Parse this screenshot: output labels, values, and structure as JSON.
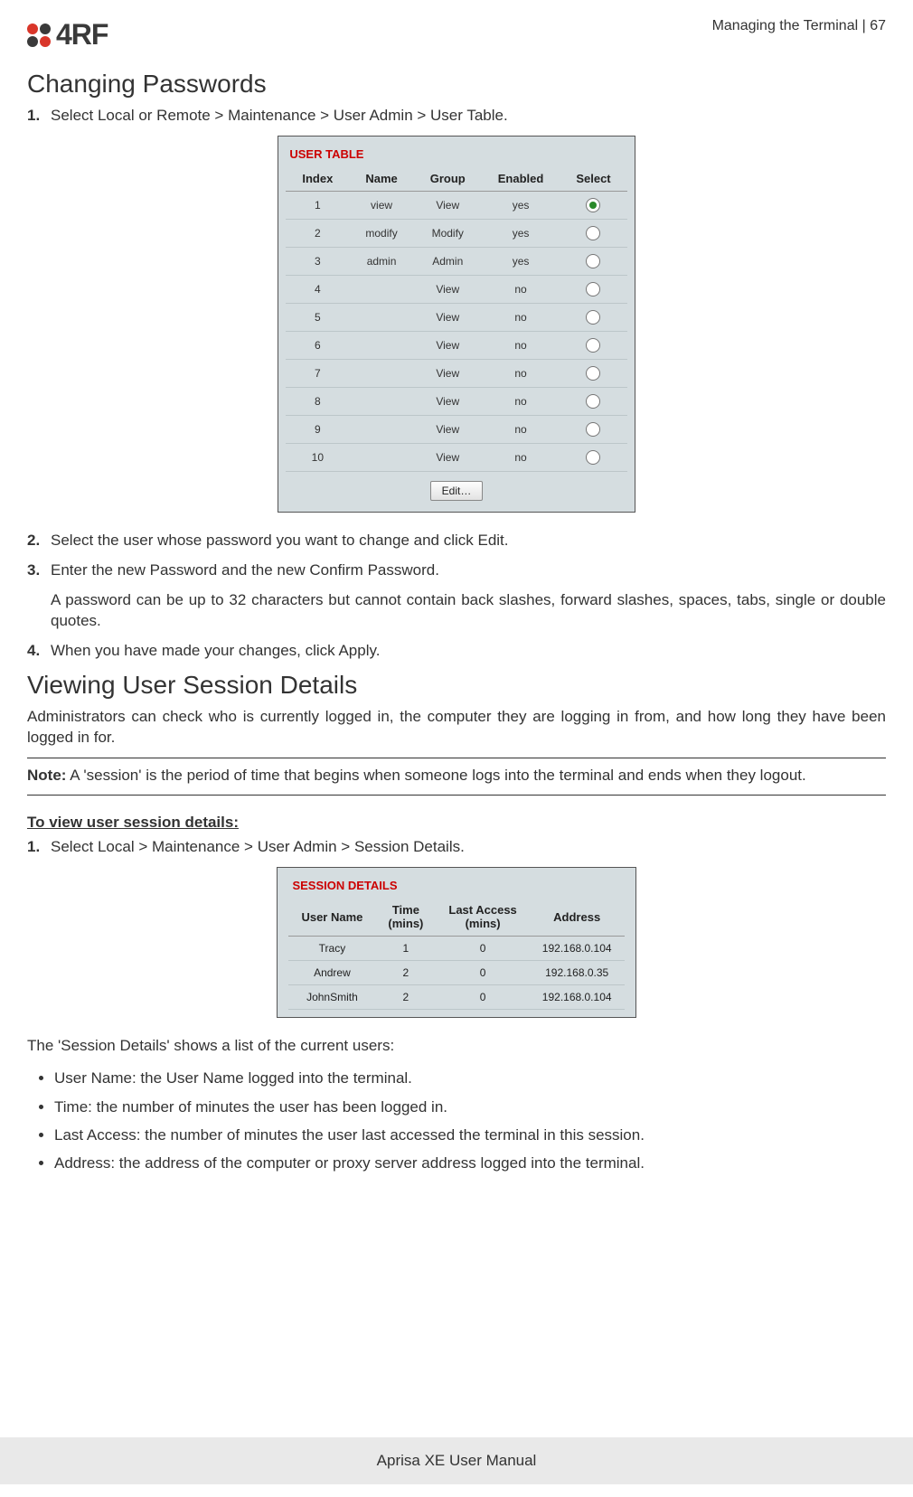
{
  "header": {
    "logo_text": "4RF",
    "page_ref": "Managing the Terminal  |  67"
  },
  "section1": {
    "title": "Changing Passwords",
    "steps": [
      {
        "num": "1.",
        "text": "Select Local or Remote > Maintenance > User Admin > User Table."
      },
      {
        "num": "2.",
        "text": "Select the user whose password you want to change and click Edit."
      },
      {
        "num": "3.",
        "text": "Enter the new Password and the new Confirm Password."
      },
      {
        "num": "4.",
        "text": "When you have made your changes, click Apply."
      }
    ],
    "step3_sub": "A password can be up to 32 characters but cannot contain back slashes, forward slashes, spaces, tabs, single or double quotes."
  },
  "user_table": {
    "title": "USER TABLE",
    "headers": [
      "Index",
      "Name",
      "Group",
      "Enabled",
      "Select"
    ],
    "rows": [
      {
        "index": "1",
        "name": "view",
        "group": "View",
        "enabled": "yes",
        "selected": true
      },
      {
        "index": "2",
        "name": "modify",
        "group": "Modify",
        "enabled": "yes",
        "selected": false
      },
      {
        "index": "3",
        "name": "admin",
        "group": "Admin",
        "enabled": "yes",
        "selected": false
      },
      {
        "index": "4",
        "name": "",
        "group": "View",
        "enabled": "no",
        "selected": false
      },
      {
        "index": "5",
        "name": "",
        "group": "View",
        "enabled": "no",
        "selected": false
      },
      {
        "index": "6",
        "name": "",
        "group": "View",
        "enabled": "no",
        "selected": false
      },
      {
        "index": "7",
        "name": "",
        "group": "View",
        "enabled": "no",
        "selected": false
      },
      {
        "index": "8",
        "name": "",
        "group": "View",
        "enabled": "no",
        "selected": false
      },
      {
        "index": "9",
        "name": "",
        "group": "View",
        "enabled": "no",
        "selected": false
      },
      {
        "index": "10",
        "name": "",
        "group": "View",
        "enabled": "no",
        "selected": false
      }
    ],
    "edit_label": "Edit…"
  },
  "section2": {
    "title": "Viewing User Session Details",
    "intro": "Administrators can check who is currently logged in, the computer they are logging in from, and how long they have been logged in for.",
    "note_label": "Note:",
    "note_text": " A 'session' is the period of time that begins when someone logs into the terminal and ends when they logout.",
    "sub_heading": "To view user session details:",
    "step1_num": "1.",
    "step1_text": "Select Local > Maintenance > User Admin > Session Details.",
    "closing": "The 'Session Details' shows a list of the current users:"
  },
  "session_details": {
    "title": "SESSION DETAILS",
    "headers": [
      "User Name",
      "Time\n(mins)",
      "Last Access\n(mins)",
      "Address"
    ],
    "rows": [
      {
        "user": "Tracy",
        "time": "1",
        "last": "0",
        "addr": "192.168.0.104"
      },
      {
        "user": "Andrew",
        "time": "2",
        "last": "0",
        "addr": "192.168.0.35"
      },
      {
        "user": "JohnSmith",
        "time": "2",
        "last": "0",
        "addr": "192.168.0.104"
      }
    ]
  },
  "bullets": [
    "User Name: the User Name logged into the terminal.",
    "Time: the number of minutes the user has been logged in.",
    "Last Access: the number of minutes the user last accessed the terminal in this session.",
    "Address: the address of the computer or proxy server address logged into the terminal."
  ],
  "footer": "Aprisa XE User Manual"
}
